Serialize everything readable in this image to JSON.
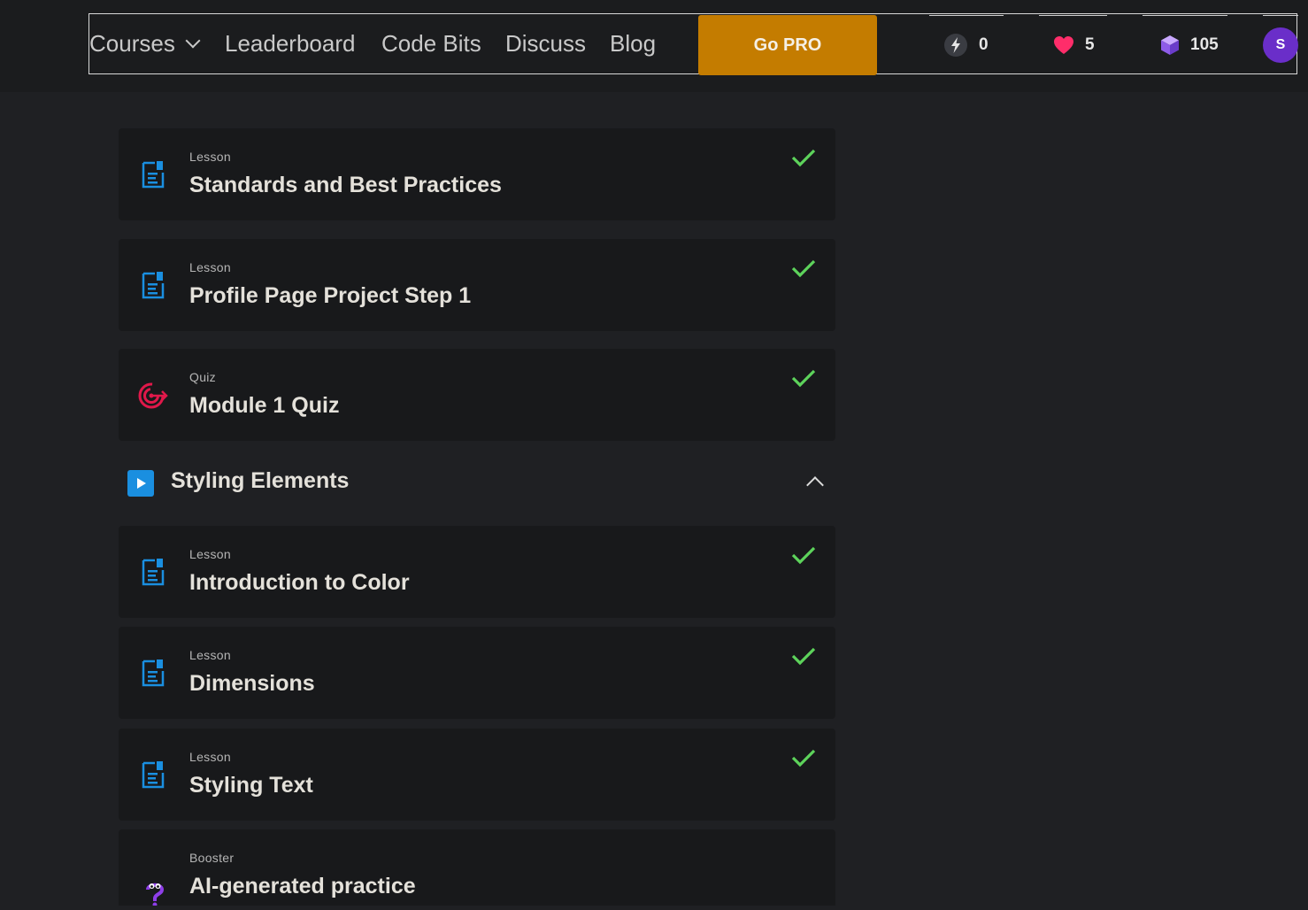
{
  "nav": {
    "courses": "Courses",
    "leaderboard": "Leaderboard",
    "code_bits": "Code Bits",
    "discuss": "Discuss",
    "blog": "Blog",
    "go_pro": "Go PRO"
  },
  "stats": {
    "streak": "0",
    "hearts": "5",
    "bits": "105"
  },
  "user": {
    "avatar_initial": "S"
  },
  "colors": {
    "accent_gold": "#c47c00",
    "check_green": "#5dd35b",
    "lesson_icon_blue": "#1a8fe0",
    "quiz_icon_red": "#e0184a",
    "heart_pink": "#ff2d6a",
    "avatar_purple": "#6a2ec9"
  },
  "items": [
    {
      "type": "Lesson",
      "title": "Standards and Best Practices",
      "icon": "document-icon",
      "completed": true
    },
    {
      "type": "Lesson",
      "title": "Profile Page Project Step 1",
      "icon": "document-icon",
      "completed": true
    },
    {
      "type": "Quiz",
      "title": "Module 1 Quiz",
      "icon": "target-icon",
      "completed": true
    }
  ],
  "section": {
    "title": "Styling Elements"
  },
  "section_items": [
    {
      "type": "Lesson",
      "title": "Introduction to Color",
      "icon": "document-icon",
      "completed": true
    },
    {
      "type": "Lesson",
      "title": "Dimensions",
      "icon": "document-icon",
      "completed": true
    },
    {
      "type": "Lesson",
      "title": "Styling Text",
      "icon": "document-icon",
      "completed": true
    },
    {
      "type": "Booster",
      "title": "AI-generated practice",
      "icon": "question-mascot-icon",
      "completed": false
    }
  ]
}
